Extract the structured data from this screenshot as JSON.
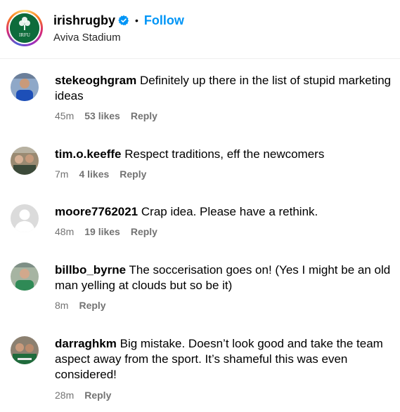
{
  "post": {
    "username": "irishrugby",
    "verified": true,
    "separator": "•",
    "follow_label": "Follow",
    "location": "Aviva Stadium",
    "logo_text": "IRFU"
  },
  "colors": {
    "follow_blue": "#0095f6",
    "meta_gray": "#737373",
    "irfu_green": "#0d6b3b"
  },
  "comments": [
    {
      "username": "stekeoghgram",
      "text": "Definitely up there in the list of stupid marketing ideas",
      "time": "45m",
      "likes": "53 likes",
      "reply": "Reply",
      "avatar": "photo-blue-shirt"
    },
    {
      "username": "tim.o.keeffe",
      "text": "Respect traditions, eff the newcomers",
      "time": "7m",
      "likes": "4 likes",
      "reply": "Reply",
      "avatar": "photo-group"
    },
    {
      "username": "moore7762021",
      "text": "Crap idea. Please have a rethink.",
      "time": "48m",
      "likes": "19 likes",
      "reply": "Reply",
      "avatar": "default-avatar"
    },
    {
      "username": "billbo_byrne",
      "text": "The soccerisation goes on! (Yes I might be an old man yelling at clouds but so be it)",
      "time": "8m",
      "likes": "",
      "reply": "Reply",
      "avatar": "photo-green-shirt"
    },
    {
      "username": "darraghkm",
      "text": "Big mistake. Doesn’t look good and take the team aspect away from the sport. It’s shameful this was even considered!",
      "time": "28m",
      "likes": "",
      "reply": "Reply",
      "avatar": "photo-two-people"
    }
  ]
}
